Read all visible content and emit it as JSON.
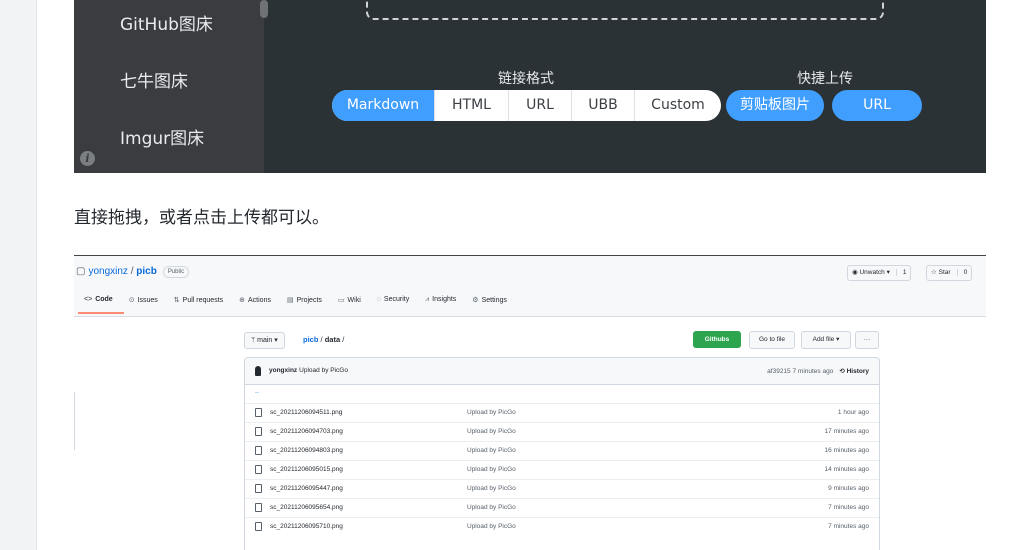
{
  "picgo": {
    "sidebar_items": [
      "GitHub图床",
      "七牛图床",
      "Imgur图床"
    ],
    "link_format_title": "链接格式",
    "link_formats": [
      "Markdown",
      "HTML",
      "URL",
      "UBB",
      "Custom"
    ],
    "active_format": "Markdown",
    "quick_upload_title": "快捷上传",
    "quick_buttons": [
      "剪贴板图片",
      "URL"
    ],
    "accent_color": "#409eff"
  },
  "paragraph": "直接拖拽，或者点击上传都可以。",
  "github": {
    "owner": "yongxinz",
    "repo": "picb",
    "visibility": "Public",
    "watch_label": "Unwatch",
    "watch_count": "1",
    "star_label": "Star",
    "star_count": "0",
    "tabs": [
      "Code",
      "Issues",
      "Pull requests",
      "Actions",
      "Projects",
      "Wiki",
      "Security",
      "Insights",
      "Settings"
    ],
    "branch": "main",
    "path_repo": "picb",
    "path_dir": "data",
    "githubs_button": "Githubs",
    "go_to_file": "Go to file",
    "add_file": "Add file",
    "more": "···",
    "commit_author": "yongxinz",
    "commit_message": "Upload by PicGo",
    "commit_hash": "af39215",
    "commit_time": "7 minutes ago",
    "history_label": "History",
    "parent_dir": "..",
    "files": [
      {
        "name": "sc_20211206094511.png",
        "message": "Upload by PicGo",
        "age": "1 hour ago"
      },
      {
        "name": "sc_20211206094703.png",
        "message": "Upload by PicGo",
        "age": "17 minutes ago"
      },
      {
        "name": "sc_20211206094803.png",
        "message": "Upload by PicGo",
        "age": "16 minutes ago"
      },
      {
        "name": "sc_20211206095015.png",
        "message": "Upload by PicGo",
        "age": "14 minutes ago"
      },
      {
        "name": "sc_20211206095447.png",
        "message": "Upload by PicGo",
        "age": "9 minutes ago"
      },
      {
        "name": "sc_20211206095654.png",
        "message": "Upload by PicGo",
        "age": "7 minutes ago"
      },
      {
        "name": "sc_20211206095710.png",
        "message": "Upload by PicGo",
        "age": "7 minutes ago"
      }
    ]
  }
}
